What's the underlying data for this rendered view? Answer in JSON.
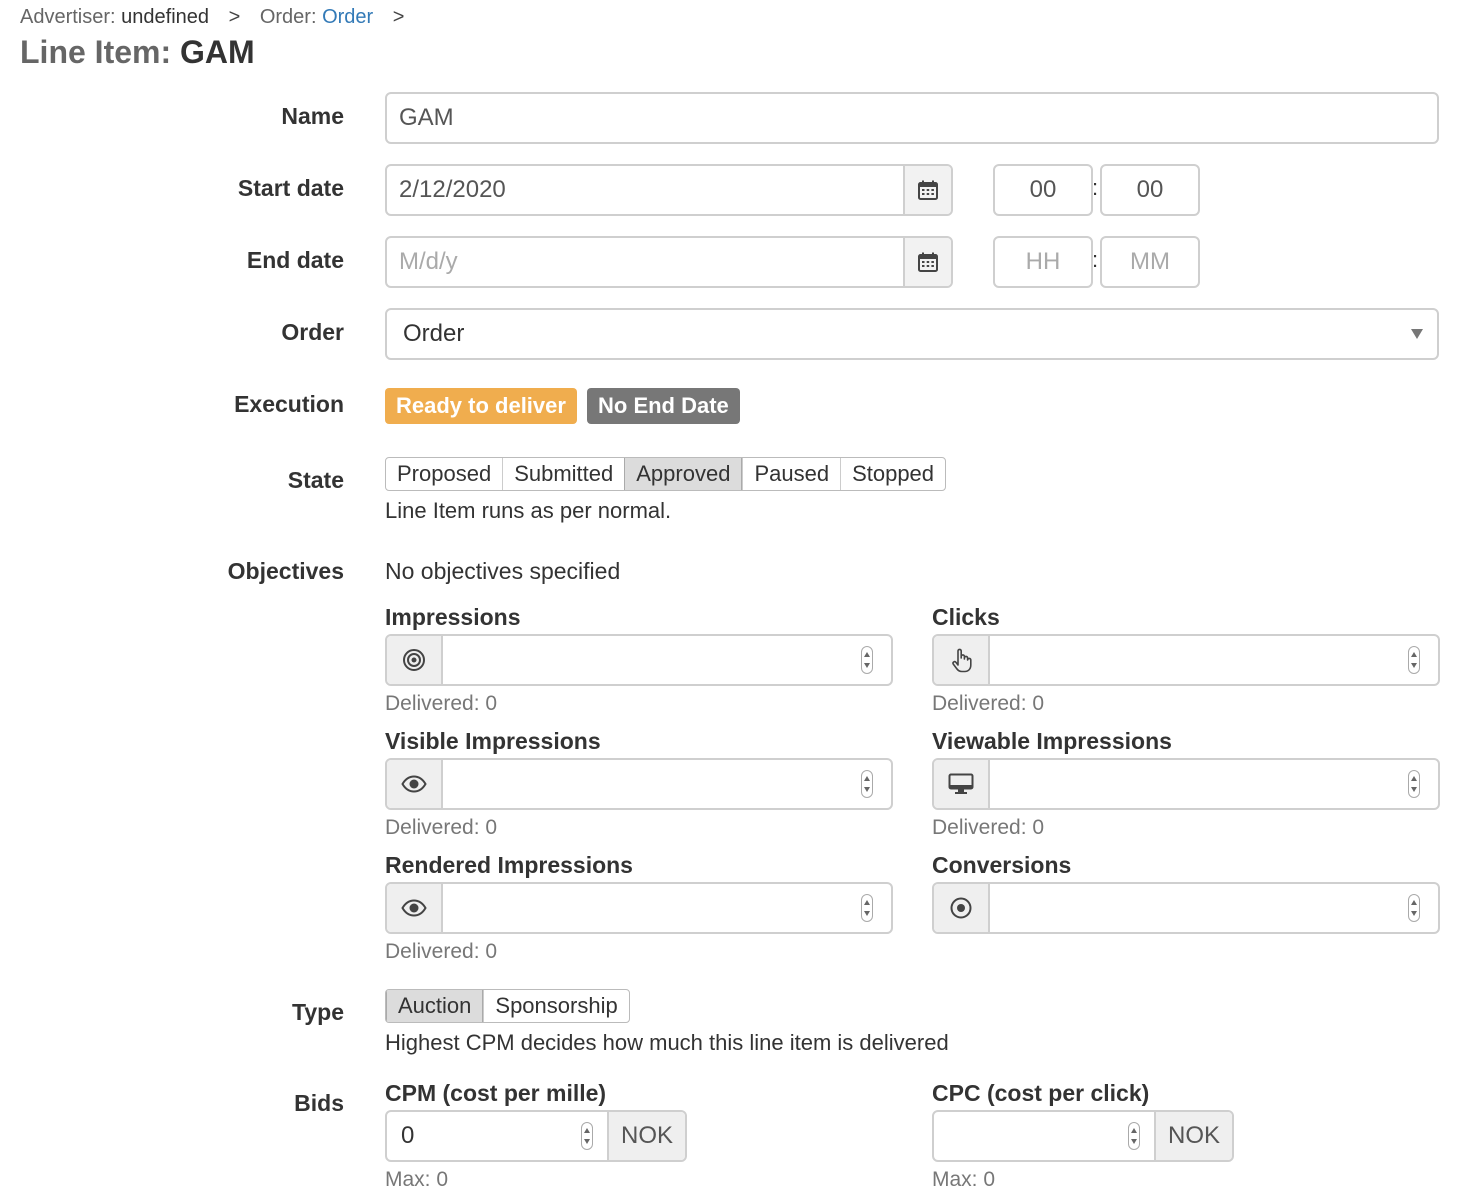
{
  "breadcrumb": {
    "advertiser_label": "Advertiser:",
    "advertiser_value": "undefined",
    "order_label": "Order:",
    "order_link": "Order",
    "separator": ">"
  },
  "title": {
    "prefix": "Line Item:",
    "name": "GAM"
  },
  "form": {
    "name": {
      "label": "Name",
      "value": "GAM"
    },
    "start_date": {
      "label": "Start date",
      "value": "2/12/2020",
      "hour": "00",
      "minute": "00"
    },
    "end_date": {
      "label": "End date",
      "placeholder": "M/d/y",
      "hour_placeholder": "HH",
      "minute_placeholder": "MM"
    },
    "time_separator": ":",
    "order": {
      "label": "Order",
      "selected": "Order"
    },
    "execution": {
      "label": "Execution",
      "badges": [
        {
          "text": "Ready to deliver",
          "color": "#f0ad4e"
        },
        {
          "text": "No End Date",
          "color": "#777777"
        }
      ]
    },
    "state": {
      "label": "State",
      "options": [
        "Proposed",
        "Submitted",
        "Approved",
        "Paused",
        "Stopped"
      ],
      "selected": "Approved",
      "help": "Line Item runs as per normal."
    },
    "objectives": {
      "label": "Objectives",
      "note": "No objectives specified",
      "items": [
        {
          "title": "Impressions",
          "icon": "target-icon",
          "delivered": "Delivered: 0"
        },
        {
          "title": "Clicks",
          "icon": "hand-pointer-icon",
          "delivered": "Delivered: 0"
        },
        {
          "title": "Visible Impressions",
          "icon": "eye-icon",
          "delivered": "Delivered: 0"
        },
        {
          "title": "Viewable Impressions",
          "icon": "desktop-icon",
          "delivered": "Delivered: 0"
        },
        {
          "title": "Rendered Impressions",
          "icon": "eye-icon",
          "delivered": "Delivered: 0"
        },
        {
          "title": "Conversions",
          "icon": "dot-circle-icon",
          "delivered": ""
        }
      ]
    },
    "type": {
      "label": "Type",
      "options": [
        "Auction",
        "Sponsorship"
      ],
      "selected": "Auction",
      "help": "Highest CPM decides how much this line item is delivered"
    },
    "bids": {
      "label": "Bids",
      "cpm": {
        "title": "CPM (cost per mille)",
        "value": "0",
        "currency": "NOK",
        "max": "Max: 0"
      },
      "cpc": {
        "title": "CPC (cost per click)",
        "value": "",
        "currency": "NOK",
        "max": "Max: 0"
      }
    }
  }
}
